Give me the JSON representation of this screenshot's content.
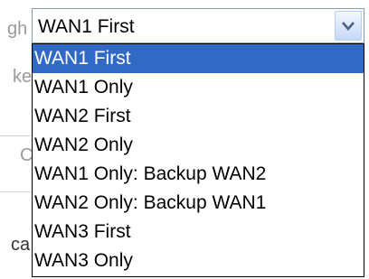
{
  "background": {
    "fragments": [
      "gh",
      "ke",
      "C",
      "ca"
    ]
  },
  "select": {
    "value": "WAN1 First",
    "arrow_icon": "chevron-down-icon",
    "options": [
      "WAN1 First",
      "WAN1 Only",
      "WAN2 First",
      "WAN2 Only",
      "WAN1 Only: Backup WAN2",
      "WAN2 Only: Backup WAN1",
      "WAN3 First",
      "WAN3 Only"
    ],
    "selected_index": 0
  },
  "colors": {
    "highlight": "#316ac5",
    "highlight_text": "#ffffff",
    "select_border": "#7f9db9",
    "list_border": "#000000",
    "arrow_color": "#4d6185"
  }
}
